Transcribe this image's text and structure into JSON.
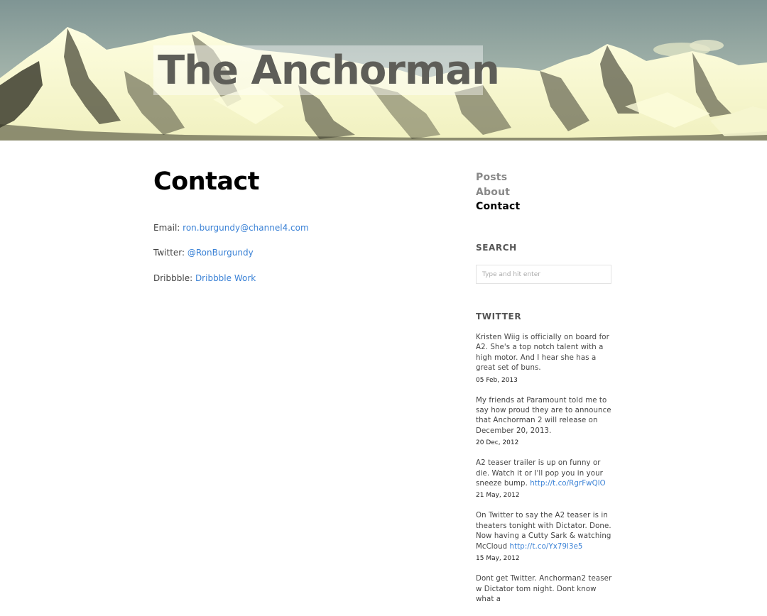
{
  "site": {
    "title": "The Anchorman"
  },
  "page": {
    "title": "Contact",
    "contacts": [
      {
        "label": "Email: ",
        "link_text": "ron.burgundy@channel4.com"
      },
      {
        "label": "Twitter: ",
        "link_text": "@RonBurgundy"
      },
      {
        "label": "Dribbble: ",
        "link_text": "Dribbble Work"
      }
    ]
  },
  "sidebar": {
    "nav": [
      {
        "label": "Posts"
      },
      {
        "label": "About"
      },
      {
        "label": "Contact"
      }
    ],
    "search": {
      "title": "SEARCH",
      "placeholder": "Type and hit enter"
    },
    "twitter": {
      "title": "TWITTER",
      "tweets": [
        {
          "text": "Kristen Wiig is officially on board for A2. She's a top notch talent with a high motor. And I hear she has a great set of buns.",
          "link": "",
          "date": "05 Feb, 2013"
        },
        {
          "text": "My friends at Paramount told me to say how proud they are to announce that Anchorman 2 will release on December 20, 2013.",
          "link": "",
          "date": "20 Dec, 2012"
        },
        {
          "text": "A2 teaser trailer is up on funny or die. Watch it or I'll pop you in your sneeze bump. ",
          "link": "http://t.co/RgrFwQlO",
          "date": "21 May, 2012"
        },
        {
          "text": "On Twitter to say the A2 teaser is in theaters tonight with Dictator. Done. Now having a Cutty Sark & watching McCloud ",
          "link": "http://t.co/Yx79l3e5",
          "date": "15 May, 2012"
        },
        {
          "text": "Dont get Twitter. Anchorman2 teaser w Dictator tom night. Dont know what a",
          "link": "",
          "date": ""
        }
      ]
    }
  },
  "colors": {
    "link": "#3b82d6",
    "nav_inactive": "#888888",
    "nav_active": "#000000",
    "sky": "#8fa3a1",
    "snow": "#fbfbd6"
  }
}
